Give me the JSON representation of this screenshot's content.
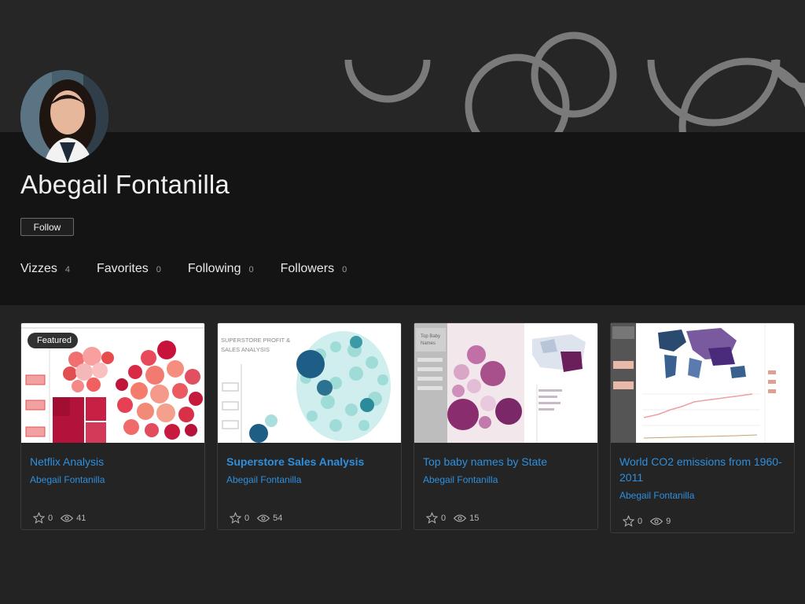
{
  "profile": {
    "name": "Abegail Fontanilla",
    "follow_label": "Follow"
  },
  "stats": [
    {
      "label": "Vizzes",
      "count": "4"
    },
    {
      "label": "Favorites",
      "count": "0"
    },
    {
      "label": "Following",
      "count": "0"
    },
    {
      "label": "Followers",
      "count": "0"
    }
  ],
  "cards": [
    {
      "title": "Netflix Analysis",
      "author": "Abegail Fontanilla",
      "favorites": "0",
      "views": "41",
      "badge": "Featured"
    },
    {
      "title": "Superstore Sales Analysis",
      "author": "Abegail Fontanilla",
      "favorites": "0",
      "views": "54"
    },
    {
      "title": "Top baby names by State",
      "author": "Abegail Fontanilla",
      "favorites": "0",
      "views": "15"
    },
    {
      "title": "World CO2 emissions from 1960-2011",
      "author": "Abegail Fontanilla",
      "favorites": "0",
      "views": "9"
    }
  ],
  "thumb_text": {
    "superstore_title": "SUPERSTORE PROFIT & SALES ANALYSIS",
    "babynames_title": "Top Baby Names"
  },
  "colors": {
    "link": "#2f8fdc",
    "banner": "#262626",
    "band": "#141414",
    "background": "#232323",
    "ring": "#7a7a7a"
  },
  "icons": [
    "star-icon",
    "eye-icon"
  ]
}
